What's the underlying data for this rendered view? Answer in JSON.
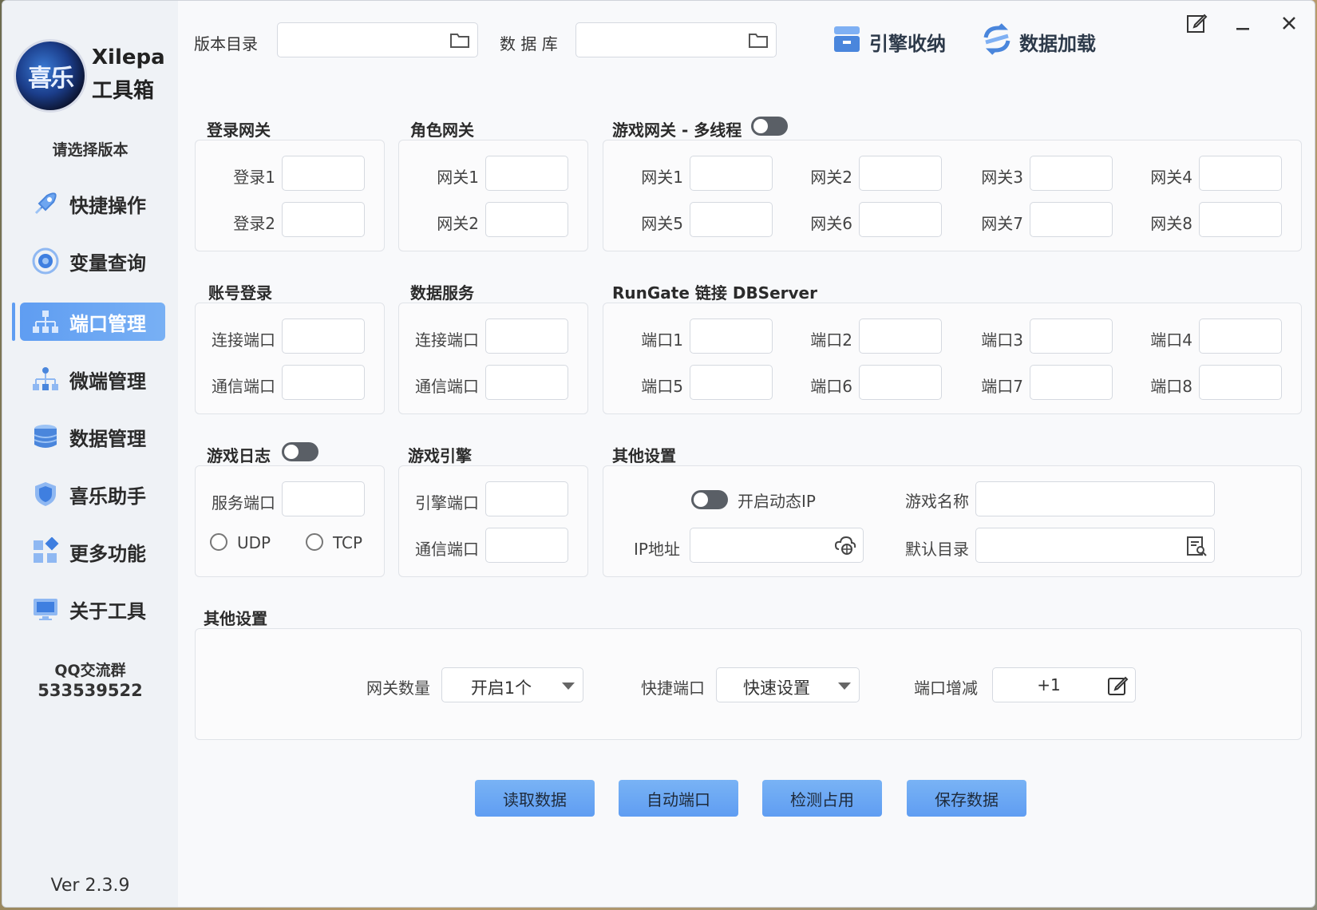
{
  "brand": {
    "logo_text": "喜乐",
    "name": "Xilepa",
    "subtitle": "工具箱"
  },
  "sidebar": {
    "choose_version": "请选择版本",
    "items": [
      {
        "label": "快捷操作",
        "icon": "rocket-icon"
      },
      {
        "label": "变量查询",
        "icon": "target-icon"
      },
      {
        "label": "端口管理",
        "icon": "network-icon"
      },
      {
        "label": "微端管理",
        "icon": "hierarchy-icon"
      },
      {
        "label": "数据管理",
        "icon": "database-icon"
      },
      {
        "label": "喜乐助手",
        "icon": "shield-icon"
      },
      {
        "label": "更多功能",
        "icon": "apps-icon"
      },
      {
        "label": "关于工具",
        "icon": "monitor-icon"
      }
    ],
    "qq_label": "QQ交流群",
    "qq_number": "533539522",
    "version": "Ver 2.3.9"
  },
  "topbar": {
    "version_dir_label": "版本目录",
    "database_label": "数 据 库",
    "engine_store": "引擎收纳",
    "data_load": "数据加载"
  },
  "login_gateway": {
    "title": "登录网关",
    "labels": [
      "登录1",
      "登录2"
    ]
  },
  "role_gateway": {
    "title": "角色网关",
    "labels": [
      "网关1",
      "网关2"
    ]
  },
  "game_gateway": {
    "title": "游戏网关 - 多线程",
    "labels": [
      "网关1",
      "网关2",
      "网关3",
      "网关4",
      "网关5",
      "网关6",
      "网关7",
      "网关8"
    ]
  },
  "account_login": {
    "title": "账号登录",
    "labels": [
      "连接端口",
      "通信端口"
    ]
  },
  "data_service": {
    "title": "数据服务",
    "labels": [
      "连接端口",
      "通信端口"
    ]
  },
  "rungate": {
    "title": "RunGate 链接 DBServer",
    "labels": [
      "端口1",
      "端口2",
      "端口3",
      "端口4",
      "端口5",
      "端口6",
      "端口7",
      "端口8"
    ]
  },
  "game_log": {
    "title": "游戏日志",
    "port_label": "服务端口",
    "udp": "UDP",
    "tcp": "TCP"
  },
  "game_engine": {
    "title": "游戏引擎",
    "labels": [
      "引擎端口",
      "通信端口"
    ]
  },
  "other_settings": {
    "title": "其他设置",
    "dynamic_ip": "开启动态IP",
    "ip_label": "IP地址",
    "game_name_label": "游戏名称",
    "default_dir_label": "默认目录"
  },
  "other_settings2": {
    "title": "其他设置",
    "gateway_count_label": "网关数量",
    "gateway_count_value": "开启1个",
    "quick_port_label": "快捷端口",
    "quick_port_value": "快速设置",
    "port_step_label": "端口增减",
    "port_step_value": "+1"
  },
  "actions": [
    "读取数据",
    "自动端口",
    "检测占用",
    "保存数据"
  ],
  "colors": {
    "accent": "#5f9df2",
    "sidebar_bg": "#eff2f6",
    "toggle": "#5a5f66"
  }
}
